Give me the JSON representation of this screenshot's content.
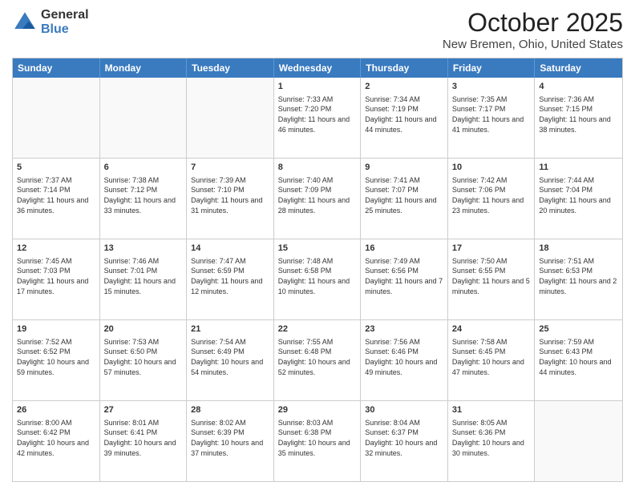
{
  "header": {
    "logo_general": "General",
    "logo_blue": "Blue",
    "title": "October 2025",
    "subtitle": "New Bremen, Ohio, United States"
  },
  "days": [
    "Sunday",
    "Monday",
    "Tuesday",
    "Wednesday",
    "Thursday",
    "Friday",
    "Saturday"
  ],
  "rows": [
    [
      {
        "day": "",
        "info": ""
      },
      {
        "day": "",
        "info": ""
      },
      {
        "day": "",
        "info": ""
      },
      {
        "day": "1",
        "info": "Sunrise: 7:33 AM\nSunset: 7:20 PM\nDaylight: 11 hours\nand 46 minutes."
      },
      {
        "day": "2",
        "info": "Sunrise: 7:34 AM\nSunset: 7:19 PM\nDaylight: 11 hours\nand 44 minutes."
      },
      {
        "day": "3",
        "info": "Sunrise: 7:35 AM\nSunset: 7:17 PM\nDaylight: 11 hours\nand 41 minutes."
      },
      {
        "day": "4",
        "info": "Sunrise: 7:36 AM\nSunset: 7:15 PM\nDaylight: 11 hours\nand 38 minutes."
      }
    ],
    [
      {
        "day": "5",
        "info": "Sunrise: 7:37 AM\nSunset: 7:14 PM\nDaylight: 11 hours\nand 36 minutes."
      },
      {
        "day": "6",
        "info": "Sunrise: 7:38 AM\nSunset: 7:12 PM\nDaylight: 11 hours\nand 33 minutes."
      },
      {
        "day": "7",
        "info": "Sunrise: 7:39 AM\nSunset: 7:10 PM\nDaylight: 11 hours\nand 31 minutes."
      },
      {
        "day": "8",
        "info": "Sunrise: 7:40 AM\nSunset: 7:09 PM\nDaylight: 11 hours\nand 28 minutes."
      },
      {
        "day": "9",
        "info": "Sunrise: 7:41 AM\nSunset: 7:07 PM\nDaylight: 11 hours\nand 25 minutes."
      },
      {
        "day": "10",
        "info": "Sunrise: 7:42 AM\nSunset: 7:06 PM\nDaylight: 11 hours\nand 23 minutes."
      },
      {
        "day": "11",
        "info": "Sunrise: 7:44 AM\nSunset: 7:04 PM\nDaylight: 11 hours\nand 20 minutes."
      }
    ],
    [
      {
        "day": "12",
        "info": "Sunrise: 7:45 AM\nSunset: 7:03 PM\nDaylight: 11 hours\nand 17 minutes."
      },
      {
        "day": "13",
        "info": "Sunrise: 7:46 AM\nSunset: 7:01 PM\nDaylight: 11 hours\nand 15 minutes."
      },
      {
        "day": "14",
        "info": "Sunrise: 7:47 AM\nSunset: 6:59 PM\nDaylight: 11 hours\nand 12 minutes."
      },
      {
        "day": "15",
        "info": "Sunrise: 7:48 AM\nSunset: 6:58 PM\nDaylight: 11 hours\nand 10 minutes."
      },
      {
        "day": "16",
        "info": "Sunrise: 7:49 AM\nSunset: 6:56 PM\nDaylight: 11 hours\nand 7 minutes."
      },
      {
        "day": "17",
        "info": "Sunrise: 7:50 AM\nSunset: 6:55 PM\nDaylight: 11 hours\nand 5 minutes."
      },
      {
        "day": "18",
        "info": "Sunrise: 7:51 AM\nSunset: 6:53 PM\nDaylight: 11 hours\nand 2 minutes."
      }
    ],
    [
      {
        "day": "19",
        "info": "Sunrise: 7:52 AM\nSunset: 6:52 PM\nDaylight: 10 hours\nand 59 minutes."
      },
      {
        "day": "20",
        "info": "Sunrise: 7:53 AM\nSunset: 6:50 PM\nDaylight: 10 hours\nand 57 minutes."
      },
      {
        "day": "21",
        "info": "Sunrise: 7:54 AM\nSunset: 6:49 PM\nDaylight: 10 hours\nand 54 minutes."
      },
      {
        "day": "22",
        "info": "Sunrise: 7:55 AM\nSunset: 6:48 PM\nDaylight: 10 hours\nand 52 minutes."
      },
      {
        "day": "23",
        "info": "Sunrise: 7:56 AM\nSunset: 6:46 PM\nDaylight: 10 hours\nand 49 minutes."
      },
      {
        "day": "24",
        "info": "Sunrise: 7:58 AM\nSunset: 6:45 PM\nDaylight: 10 hours\nand 47 minutes."
      },
      {
        "day": "25",
        "info": "Sunrise: 7:59 AM\nSunset: 6:43 PM\nDaylight: 10 hours\nand 44 minutes."
      }
    ],
    [
      {
        "day": "26",
        "info": "Sunrise: 8:00 AM\nSunset: 6:42 PM\nDaylight: 10 hours\nand 42 minutes."
      },
      {
        "day": "27",
        "info": "Sunrise: 8:01 AM\nSunset: 6:41 PM\nDaylight: 10 hours\nand 39 minutes."
      },
      {
        "day": "28",
        "info": "Sunrise: 8:02 AM\nSunset: 6:39 PM\nDaylight: 10 hours\nand 37 minutes."
      },
      {
        "day": "29",
        "info": "Sunrise: 8:03 AM\nSunset: 6:38 PM\nDaylight: 10 hours\nand 35 minutes."
      },
      {
        "day": "30",
        "info": "Sunrise: 8:04 AM\nSunset: 6:37 PM\nDaylight: 10 hours\nand 32 minutes."
      },
      {
        "day": "31",
        "info": "Sunrise: 8:05 AM\nSunset: 6:36 PM\nDaylight: 10 hours\nand 30 minutes."
      },
      {
        "day": "",
        "info": ""
      }
    ]
  ]
}
